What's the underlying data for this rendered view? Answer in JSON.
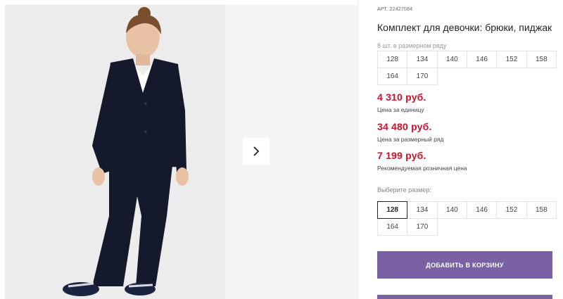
{
  "gallery": {
    "main_image_icon": "girl-in-school-suit-photo",
    "next_icon": "chevron-right-icon"
  },
  "product": {
    "sku_prefix": "АРТ.",
    "sku": "22427084",
    "title": "Комплект для девочки: брюки, пиджак",
    "pack_note": "8 шт. в размерном ряду",
    "pack_sizes": [
      "128",
      "134",
      "140",
      "146",
      "152",
      "158",
      "164",
      "170"
    ]
  },
  "prices": {
    "unit_price": "4 310 руб.",
    "unit_label": "Цена за единицу",
    "pack_price": "34 480 руб.",
    "pack_label": "Цена за размерный ряд",
    "retail_price": "7 199 руб.",
    "retail_label": "Рекомендуемая розничная цена"
  },
  "size_select": {
    "label": "Выберите размер:",
    "options": [
      "128",
      "134",
      "140",
      "146",
      "152",
      "158",
      "164",
      "170"
    ],
    "selected": "128"
  },
  "actions": {
    "add_to_cart": "ДОБАВИТЬ В КОРЗИНУ"
  },
  "colors": {
    "accent": "#7a61a3",
    "price": "#d0112b"
  }
}
